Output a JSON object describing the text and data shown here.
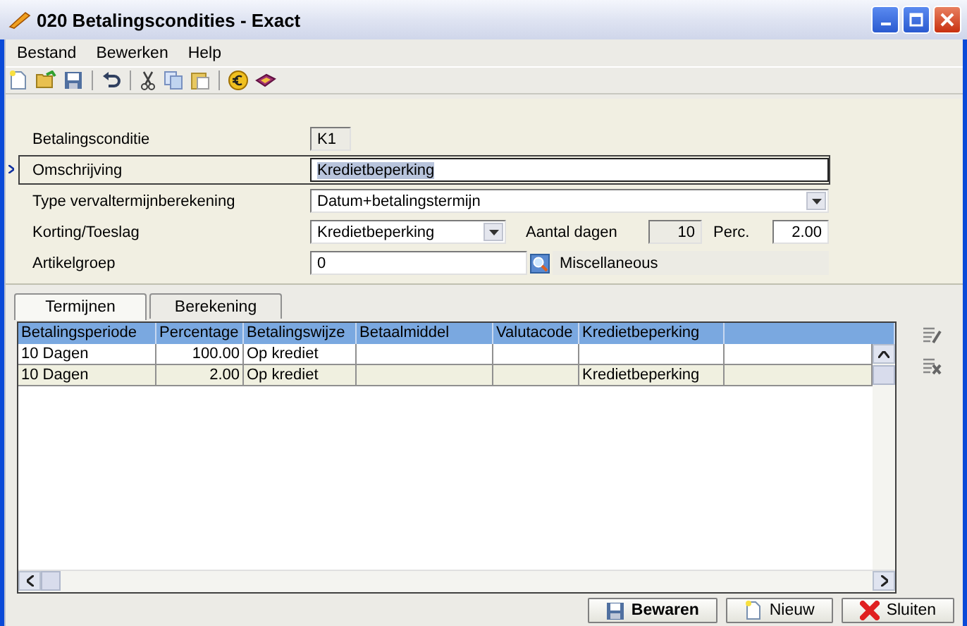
{
  "window": {
    "title": "020 Betalingscondities - Exact"
  },
  "menu": [
    "Bestand",
    "Bewerken",
    "Help"
  ],
  "form": {
    "fields": [
      {
        "kind": "readonly",
        "label": "Betalingsconditie",
        "value": "K1",
        "focused": false
      },
      {
        "kind": "text",
        "label": "Omschrijving",
        "value": "Kredietbeperking",
        "focused": true
      },
      {
        "kind": "combo",
        "label": "Type vervaltermijnberekening",
        "value": "Datum+betalingstermijn",
        "focused": false
      },
      {
        "kind": "korting",
        "label": "Korting/Toeslag",
        "value": "Kredietbeperking",
        "focused": false,
        "days_label": "Aantal dagen",
        "days": "10",
        "perc_label": "Perc.",
        "perc": "2.00"
      },
      {
        "kind": "lookup",
        "label": "Artikelgroep",
        "value": "0",
        "focused": false,
        "description": "Miscellaneous"
      }
    ]
  },
  "tabs": [
    {
      "label": "Termijnen",
      "selected": true
    },
    {
      "label": "Berekening",
      "selected": false
    }
  ],
  "table": {
    "columns": [
      "Betalingsperiode",
      "Percentage",
      "Betalingswijze",
      "Betaalmiddel",
      "Valutacode",
      "Kredietbeperking"
    ],
    "rows": [
      [
        "10 Dagen",
        "100.00",
        "Op krediet",
        "",
        "",
        ""
      ],
      [
        "10 Dagen",
        "2.00",
        "Op krediet",
        "",
        "",
        "Kredietbeperking"
      ]
    ]
  },
  "buttons": [
    {
      "kind": "save",
      "label": "Bewaren"
    },
    {
      "kind": "new",
      "label": "Nieuw"
    },
    {
      "kind": "close",
      "label": "Sluiten"
    }
  ]
}
